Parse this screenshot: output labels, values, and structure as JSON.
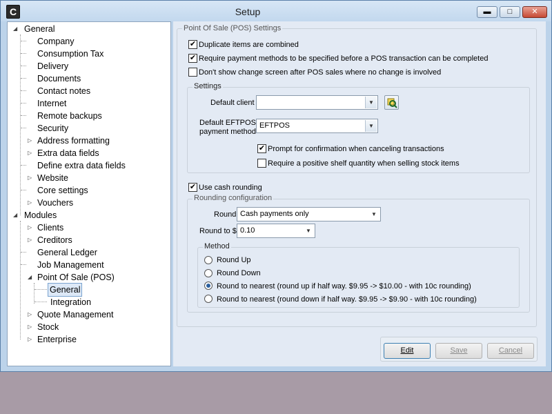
{
  "window": {
    "title": "Setup",
    "icon_letter": "C",
    "min_glyph": "▬",
    "max_glyph": "□",
    "close_glyph": "✕"
  },
  "tree": {
    "general": {
      "label": "General",
      "items": [
        "Company",
        "Consumption Tax",
        "Delivery",
        "Documents",
        "Contact notes",
        "Internet",
        "Remote backups",
        "Security",
        "Address formatting",
        "Extra data fields",
        "Define extra data fields",
        "Website",
        "Core settings",
        "Vouchers"
      ]
    },
    "modules": {
      "label": "Modules",
      "items": [
        "Clients",
        "Creditors",
        "General Ledger",
        "Job Management",
        "Point Of Sale (POS)",
        "General",
        "Integration",
        "Quote Management",
        "Stock",
        "Enterprise"
      ]
    }
  },
  "pos": {
    "group_title": "Point Of Sale (POS) Settings",
    "options": [
      {
        "label": "Duplicate items are combined",
        "checked": true
      },
      {
        "label": "Require payment methods to be specified before a POS transaction can be completed",
        "checked": true
      },
      {
        "label": "Don't show change screen after POS sales where no change is involved",
        "checked": false
      }
    ],
    "settings": {
      "title": "Settings",
      "default_client_label": "Default client",
      "default_client_value": "",
      "eftpos_label_1": "Default EFTPOS",
      "eftpos_label_2": "payment method",
      "eftpos_value": "EFTPOS",
      "prompt_label": "Prompt for confirmation when canceling transactions",
      "prompt_checked": true,
      "shelf_label": "Require a positive shelf quantity when selling stock items",
      "shelf_checked": false
    },
    "cash_rounding": {
      "label": "Use cash rounding",
      "checked": true
    },
    "rounding": {
      "title": "Rounding configuration",
      "round_label": "Round",
      "round_value": "Cash payments only",
      "round_to_label": "Round to $",
      "round_to_value": "0.10",
      "method_title": "Method",
      "methods": [
        {
          "label": "Round Up",
          "selected": false
        },
        {
          "label": "Round Down",
          "selected": false
        },
        {
          "label": "Round to nearest (round up if half way.  $9.95 -> $10.00    - with 10c rounding)",
          "selected": true
        },
        {
          "label": "Round to nearest (round down if half way.  $9.95 -> $9.90    - with 10c rounding)",
          "selected": false
        }
      ]
    }
  },
  "buttons": {
    "edit": "Edit",
    "save": "Save",
    "cancel": "Cancel"
  },
  "glyphs": {
    "check": "✔",
    "dropdown": "▼",
    "expanded": "◢",
    "collapsed": "▷"
  }
}
